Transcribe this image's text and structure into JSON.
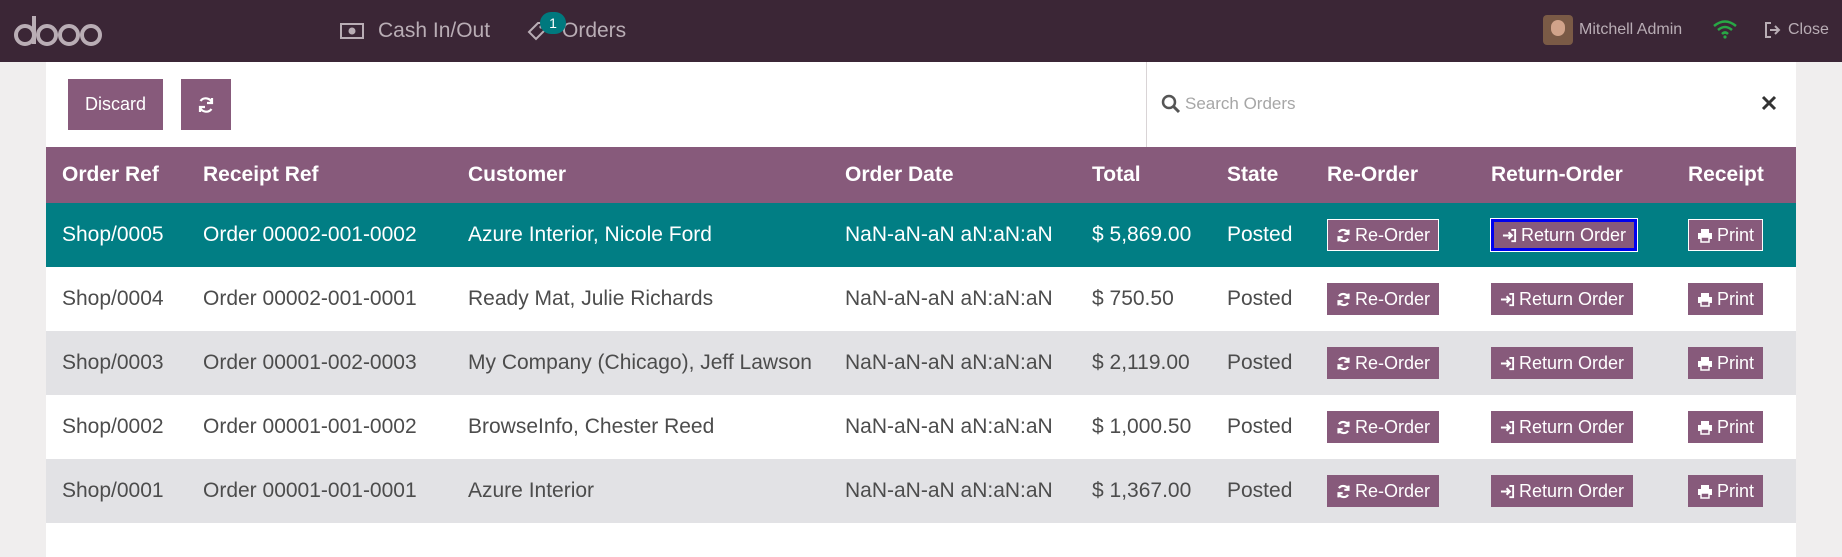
{
  "topbar": {
    "logo_text": "odoo",
    "nav": [
      {
        "label": "Cash In/Out",
        "icon": "money-icon"
      },
      {
        "label": "Orders",
        "icon": "ticket-icon",
        "badge": "1"
      }
    ],
    "user_name": "Mitchell Admin",
    "close_label": "Close"
  },
  "controls": {
    "discard_label": "Discard",
    "search_placeholder": "Search Orders"
  },
  "table": {
    "columns": [
      "Order Ref",
      "Receipt Ref",
      "Customer",
      "Order Date",
      "Total",
      "State",
      "Re-Order",
      "Return-Order",
      "Receipt"
    ],
    "rows": [
      {
        "order_ref": "Shop/0005",
        "receipt_ref": "Order 00002-001-0002",
        "customer": "Azure Interior, Nicole Ford",
        "date": "NaN-aN-aN aN:aN:aN",
        "total": "$ 5,869.00",
        "state": "Posted",
        "reorder": "Re-Order",
        "return": "Return Order",
        "receipt": "Print"
      },
      {
        "order_ref": "Shop/0004",
        "receipt_ref": "Order 00002-001-0001",
        "customer": "Ready Mat, Julie Richards",
        "date": "NaN-aN-aN aN:aN:aN",
        "total": "$ 750.50",
        "state": "Posted",
        "reorder": "Re-Order",
        "return": "Return Order",
        "receipt": "Print"
      },
      {
        "order_ref": "Shop/0003",
        "receipt_ref": "Order 00001-002-0003",
        "customer": "My Company (Chicago), Jeff Lawson",
        "date": "NaN-aN-aN aN:aN:aN",
        "total": "$ 2,119.00",
        "state": "Posted",
        "reorder": "Re-Order",
        "return": "Return Order",
        "receipt": "Print"
      },
      {
        "order_ref": "Shop/0002",
        "receipt_ref": "Order 00001-001-0002",
        "customer": "BrowseInfo, Chester Reed",
        "date": "NaN-aN-aN aN:aN:aN",
        "total": "$ 1,000.50",
        "state": "Posted",
        "reorder": "Re-Order",
        "return": "Return Order",
        "receipt": "Print"
      },
      {
        "order_ref": "Shop/0001",
        "receipt_ref": "Order 00001-001-0001",
        "customer": "Azure Interior",
        "date": "NaN-aN-aN aN:aN:aN",
        "total": "$ 1,367.00",
        "state": "Posted",
        "reorder": "Re-Order",
        "return": "Return Order",
        "receipt": "Print"
      }
    ]
  },
  "colors": {
    "topbar": "#3b2636",
    "accent": "#875a7b",
    "selected_row": "#017e84",
    "alt_row": "#e2e2e5",
    "focus_ring": "#0000ee",
    "wifi": "#28a745"
  }
}
